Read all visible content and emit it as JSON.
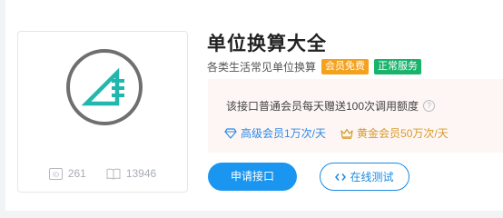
{
  "api": {
    "title": "单位换算大全",
    "subtitle": "各类生活常见单位换算",
    "badges": [
      {
        "label": "会员免费",
        "color": "#f5a11b"
      },
      {
        "label": "正常服务",
        "color": "#19b36b"
      }
    ],
    "stats": {
      "id_value": "261",
      "views_value": "13946"
    }
  },
  "info": {
    "quota_text": "该接口普通会员每天赠送100次调用额度",
    "tiers": [
      {
        "label": "高级会员1万次/天",
        "color": "#2e8ae6",
        "icon": "diamond-icon"
      },
      {
        "label": "黄金会员50万次/天",
        "color": "#d89a2a",
        "icon": "crown-icon"
      }
    ]
  },
  "actions": {
    "apply_label": "申请接口",
    "test_label": "在线测试"
  },
  "colors": {
    "accent": "#1a96f0",
    "logo": "#22b7ad",
    "logo_ring": "#6f6f6f"
  }
}
